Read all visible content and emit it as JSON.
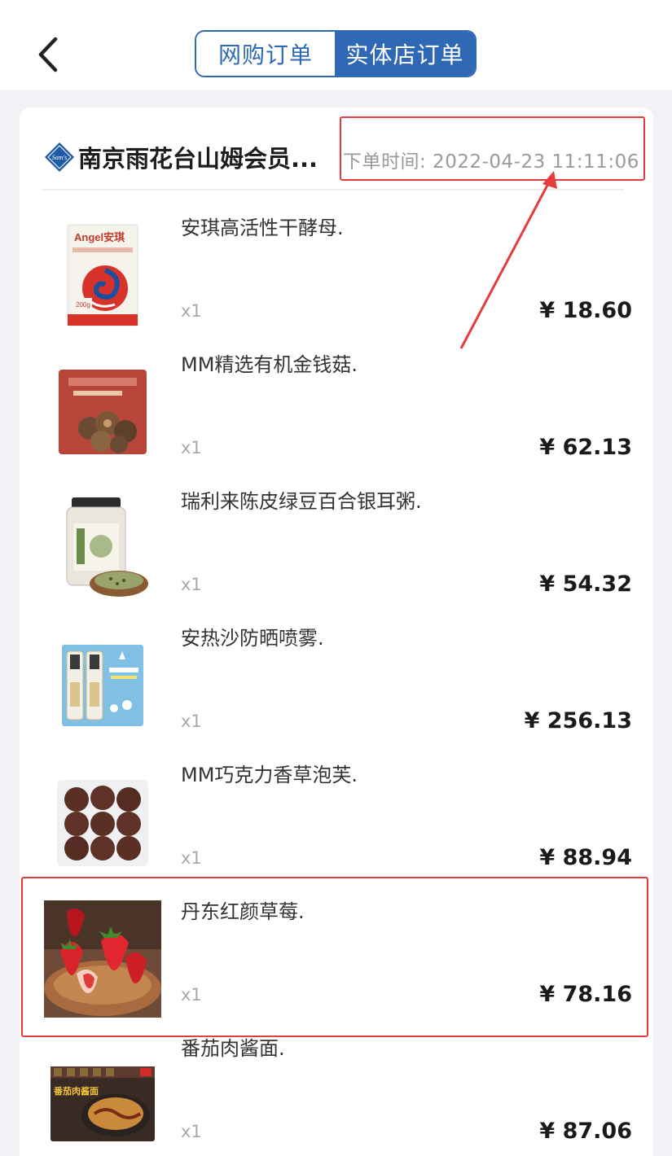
{
  "header": {
    "back_icon": "chevron-left-icon",
    "tabs": [
      {
        "label": "网购订单",
        "active": false
      },
      {
        "label": "实体店订单",
        "active": true
      }
    ]
  },
  "order": {
    "store_name": "南京雨花台山姆会员...",
    "store_logo_text": "Sam's",
    "order_time": "下单时间: 2022-04-23 11:11:06",
    "items": [
      {
        "name": "安琪高活性干酵母.",
        "qty": "x1",
        "price": "¥ 18.60",
        "thumb": "yeast-package-image",
        "brand": "Angel安琪",
        "weight": "200g"
      },
      {
        "name": "MM精选有机金钱菇.",
        "qty": "x1",
        "price": "¥ 62.13",
        "thumb": "mushroom-package-image"
      },
      {
        "name": "瑞利来陈皮绿豆百合银耳粥.",
        "qty": "x1",
        "price": "¥ 54.32",
        "thumb": "porridge-jar-image"
      },
      {
        "name": "安热沙防晒喷雾.",
        "qty": "x1",
        "price": "¥ 256.13",
        "thumb": "sunscreen-spray-image"
      },
      {
        "name": "MM巧克力香草泡芙.",
        "qty": "x1",
        "price": "¥ 88.94",
        "thumb": "chocolate-puff-image"
      },
      {
        "name": "丹东红颜草莓.",
        "qty": "x1",
        "price": "¥ 78.16",
        "thumb": "strawberry-image"
      },
      {
        "name": "番茄肉酱面.",
        "qty": "x1",
        "price": "¥ 87.06",
        "thumb": "tomato-meat-noodles-image",
        "box_text": "番茄肉酱面"
      }
    ]
  },
  "colors": {
    "accent": "#2f68b4",
    "annotation": "#e53b3b",
    "background": "#f1f3f6"
  }
}
